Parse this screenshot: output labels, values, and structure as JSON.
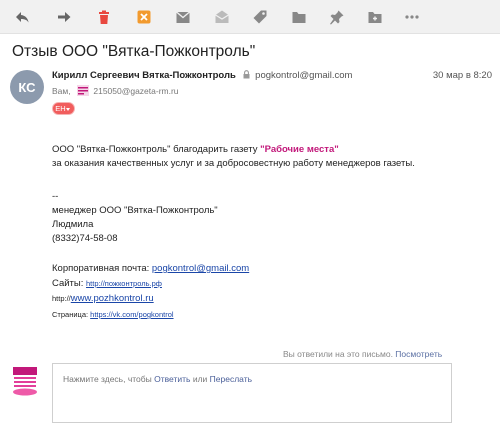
{
  "toolbar": {
    "buttons": [
      {
        "name": "reply-icon",
        "color": "#666666"
      },
      {
        "name": "forward-icon",
        "color": "#666666"
      },
      {
        "name": "trash-icon",
        "color": "#e8483f"
      },
      {
        "name": "spam-icon",
        "color": "#f29a2e"
      },
      {
        "name": "archive-icon",
        "color": "#888888"
      },
      {
        "name": "mark-unread-icon",
        "color": "#bbbbbb"
      },
      {
        "name": "tag-icon",
        "color": "#888888"
      },
      {
        "name": "folder-icon",
        "color": "#888888"
      },
      {
        "name": "pin-icon",
        "color": "#888888"
      },
      {
        "name": "move-folder-icon",
        "color": "#888888"
      },
      {
        "name": "more-icon",
        "color": "#888888"
      }
    ]
  },
  "subject": "Отзыв ООО \"Вятка-Пожконтроль\"",
  "sender": {
    "initials": "КС",
    "name": "Кирилл Сергеевич Вятка-Пожконтроль",
    "email": "pogkontrol@gmail.com",
    "date": "30 мар в 8:20",
    "to_label": "Вам,",
    "to_email": "215050@gazeta-rm.ru",
    "lang_badge": "EH"
  },
  "body": {
    "line1_prefix": "ООО \"Вятка-Пожконтроль\" благодарить газету ",
    "line1_highlight": "\"Рабочие места\"",
    "line2": "за оказания качественных услуг и за добросовестную работу менеджеров газеты.",
    "sig_sep": "--",
    "sig_title": "менеджер ООО \"Вятка-Пожконтроль\"",
    "sig_name": "Людмила",
    "sig_phone": "(8332)74-58-08",
    "mail_label": "Корпоративная почта: ",
    "mail_link": "pogkontrol@gmail.com",
    "sites_label": "Сайты: ",
    "sites_link": "http://пожконтроль.рф",
    "http_label": "http://",
    "http_link": "www.pozhkontrol.ru",
    "page_label": "Страница: ",
    "page_link": "https://vk.com/pogkontrol"
  },
  "reply": {
    "replied_text": "Вы ответили на это письмо. ",
    "view_link": "Посмотреть",
    "logo_text": "ГАЗЕТА О РАБОТЕ РАБОЧИЕ МЕСТА",
    "prompt_prefix": "Нажмите здесь, чтобы ",
    "reply_link": "Ответить",
    "or_text": " или ",
    "forward_link": "Переслать"
  }
}
